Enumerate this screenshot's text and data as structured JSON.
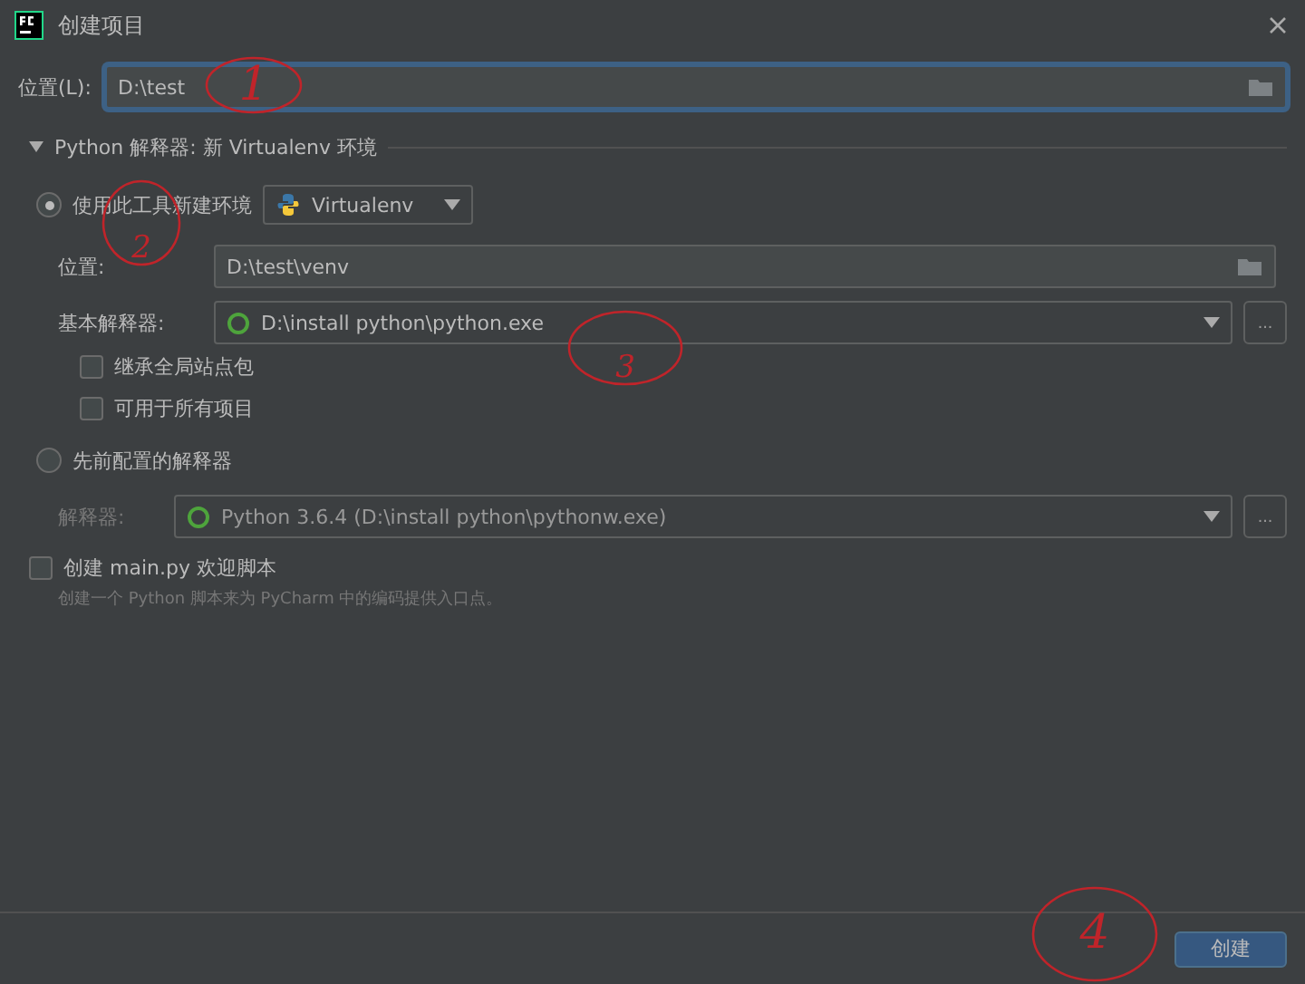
{
  "window": {
    "title": "创建项目"
  },
  "location": {
    "label": "位置(L):",
    "value": "D:\\test",
    "focused": true
  },
  "section": {
    "title": "Python 解释器: 新 Virtualenv 环境",
    "expanded": true
  },
  "new_env": {
    "label": "使用此工具新建环境",
    "selected": true,
    "tool": "Virtualenv",
    "location_label": "位置:",
    "location_value": "D:\\test\\venv",
    "base_label": "基本解释器:",
    "base_value": "D:\\install python\\python.exe",
    "browse": "...",
    "options": [
      {
        "label": "继承全局站点包",
        "checked": false
      },
      {
        "label": "可用于所有项目",
        "checked": false
      }
    ]
  },
  "existing": {
    "label": "先前配置的解释器",
    "selected": false,
    "disabled": true,
    "interp_label": "解释器:",
    "interp_value": "Python 3.6.4 (D:\\install python\\pythonw.exe)",
    "browse": "..."
  },
  "welcome": {
    "label": "创建 main.py 欢迎脚本",
    "checked": false,
    "hint": "创建一个 Python 脚本来为 PyCharm 中的编码提供入口点。"
  },
  "create_button": "创建",
  "annotations": [
    {
      "label": "1"
    },
    {
      "label": "2"
    },
    {
      "label": "3"
    },
    {
      "label": "4"
    }
  ]
}
